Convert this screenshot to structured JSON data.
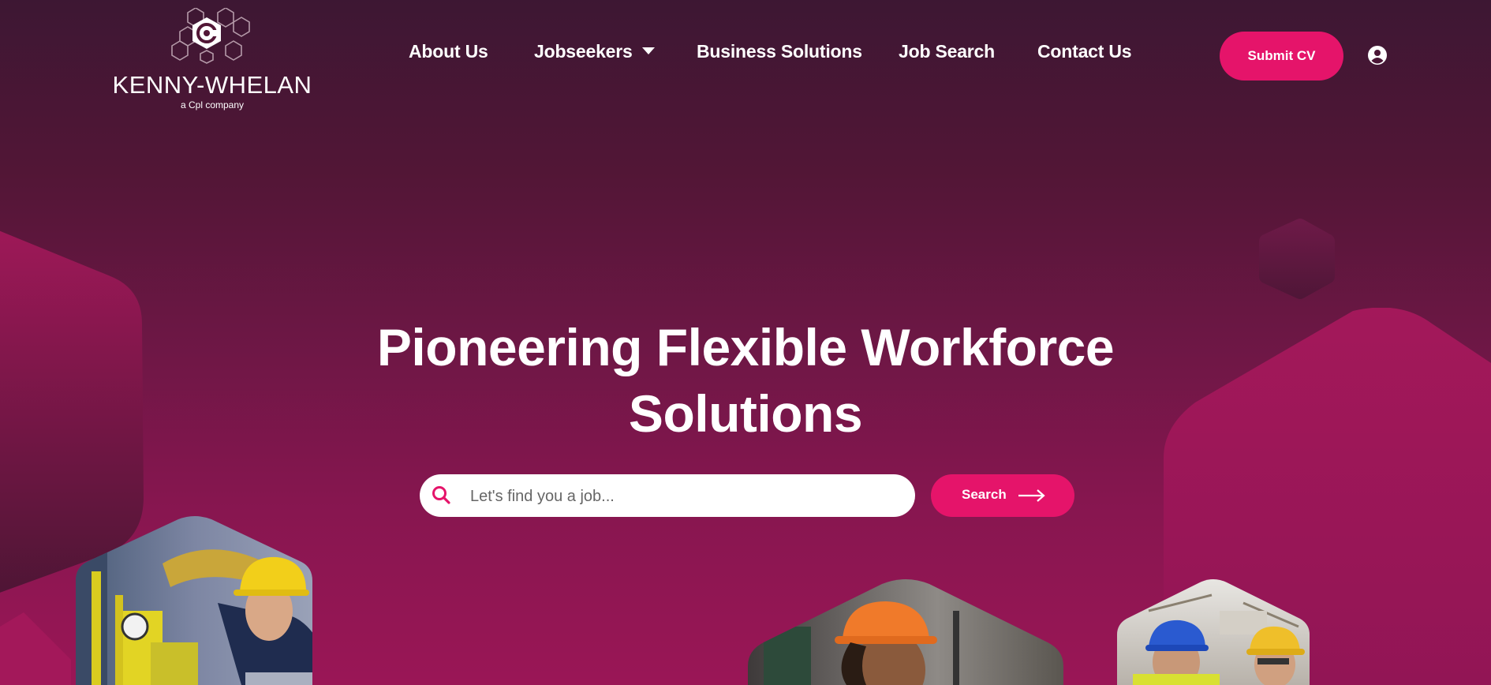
{
  "brand": {
    "name": "KENNY-WHELAN",
    "tagline": "a Cpl company"
  },
  "nav": {
    "items": [
      {
        "label": "About Us"
      },
      {
        "label": "Jobseekers",
        "has_dropdown": true
      },
      {
        "label": "Business Solutions"
      },
      {
        "label": "Job Search"
      },
      {
        "label": "Contact Us"
      }
    ],
    "submit_cv": "Submit CV",
    "account_icon": "user-circle-icon"
  },
  "hero": {
    "title_line1": "Pioneering Flexible Workforce",
    "title_line2": "Solutions"
  },
  "search": {
    "placeholder": "Let's find you a job...",
    "value": "",
    "button_label": "Search",
    "icon": "search-icon",
    "button_icon": "arrow-right-icon"
  },
  "colors": {
    "accent": "#e5146a",
    "background_top": "#3d1733",
    "background_bottom": "#9a1656"
  },
  "photos": [
    {
      "subject": "engineer-yellow-hardhat"
    },
    {
      "subject": "worker-orange-hardhat"
    },
    {
      "subject": "two-workers-hardhats"
    }
  ]
}
